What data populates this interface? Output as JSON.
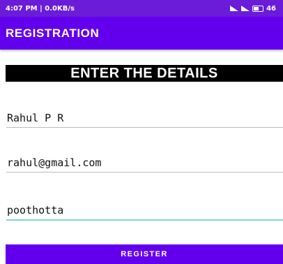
{
  "status_bar": {
    "time_info": "4:07 PM | 0.0KB/s",
    "battery": "46"
  },
  "app_bar": {
    "title": "REGISTRATION"
  },
  "form": {
    "heading": "ENTER THE DETAILS",
    "name_value": "Rahul P R",
    "email_value": "rahul@gmail.com",
    "address_value": "poothotta",
    "register_label": "REGISTER"
  },
  "colors": {
    "primary": "#6200ee",
    "status_bar": "#6a1cd8",
    "heading_bg": "#000000",
    "focus_underline": "#7fd6d0"
  }
}
